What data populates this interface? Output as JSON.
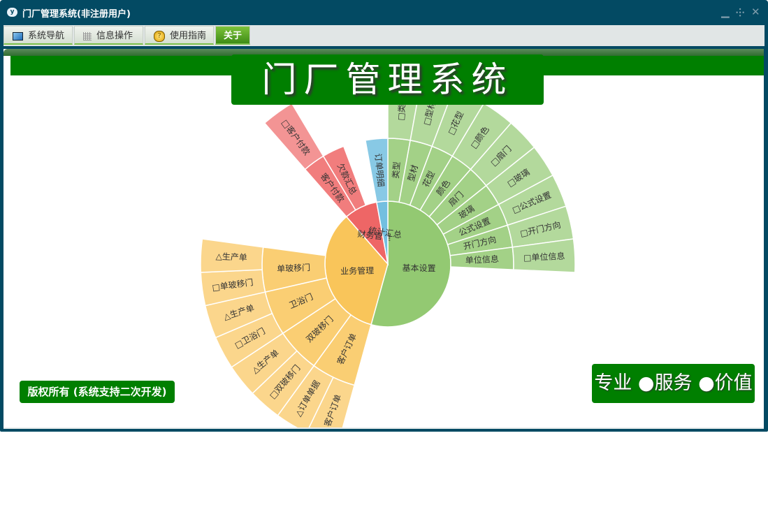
{
  "window": {
    "title": "门厂管理系统(非注册用户)",
    "controls": [
      "minimize-icon",
      "restore-icon",
      "close-icon"
    ]
  },
  "tabs": [
    {
      "label": "系统导航",
      "icon": "monitor-icon"
    },
    {
      "label": "信息操作",
      "icon": "grid-icon"
    },
    {
      "label": "使用指南",
      "icon": "help-icon"
    },
    {
      "label": "关于",
      "active": true
    }
  ],
  "banner": {
    "title": "门厂管理系统"
  },
  "copyright": "版权所有 (系统支持二次开发)",
  "slogan": "专业 ●服务 ●价值",
  "colors": {
    "accent": "#007f00",
    "frame": "#034a63"
  },
  "chart_data": {
    "type": "sunburst",
    "data": [
      {
        "name": "基本设置",
        "value": 19,
        "color": "#93c972",
        "children": [
          {
            "name": "类型",
            "value": 1,
            "children": [
              {
                "name": "□类型",
                "value": 1
              }
            ]
          },
          {
            "name": "型材",
            "value": 1,
            "children": [
              {
                "name": "□型材",
                "value": 1
              }
            ]
          },
          {
            "name": "花型",
            "value": 1,
            "children": [
              {
                "name": "□花型",
                "value": 1
              }
            ]
          },
          {
            "name": "颜色",
            "value": 1,
            "children": [
              {
                "name": "□颜色",
                "value": 1
              }
            ]
          },
          {
            "name": "扇门",
            "value": 1,
            "children": [
              {
                "name": "□扇门",
                "value": 1
              }
            ]
          },
          {
            "name": "玻璃",
            "value": 1,
            "children": [
              {
                "name": "□玻璃",
                "value": 1
              }
            ]
          },
          {
            "name": "公式设置",
            "value": 1,
            "children": [
              {
                "name": "□公式设置",
                "value": 1
              }
            ]
          },
          {
            "name": "开门方向",
            "value": 1,
            "children": [
              {
                "name": "□开门方向",
                "value": 1
              }
            ]
          },
          {
            "name": "单位信息",
            "value": 1,
            "children": [
              {
                "name": "□单位信息",
                "value": 1
              }
            ]
          }
        ]
      },
      {
        "name": "业务管理",
        "value": 12,
        "color": "#f9c55a",
        "children": [
          {
            "name": "客户订单",
            "value": 2,
            "children": [
              {
                "name": "客户订单",
                "value": 1
              },
              {
                "name": "△订单单据",
                "value": 1
              }
            ]
          },
          {
            "name": "双玻移门",
            "value": 2,
            "children": [
              {
                "name": "□双玻移门",
                "value": 1
              },
              {
                "name": "△生产单",
                "value": 1
              }
            ]
          },
          {
            "name": "卫浴门",
            "value": 2,
            "children": [
              {
                "name": "□卫浴门",
                "value": 1
              },
              {
                "name": "△生产单",
                "value": 1
              }
            ]
          },
          {
            "name": "单玻移门",
            "value": 2,
            "children": [
              {
                "name": "□单玻移门",
                "value": 1
              },
              {
                "name": "△生产单",
                "value": 1
              }
            ]
          }
        ]
      },
      {
        "name": "财务管理",
        "value": 3,
        "color": "#ee6666",
        "children": [
          {
            "name": "客户付款",
            "value": 1,
            "children": [
              {
                "name": "□客户付款",
                "value": 1
              }
            ]
          },
          {
            "name": "欠款汇总",
            "value": 1
          }
        ]
      },
      {
        "name": "统计汇总",
        "value": 1,
        "color": "#73bfe0",
        "children": [
          {
            "name": "订单明细",
            "value": 1
          }
        ]
      }
    ]
  }
}
